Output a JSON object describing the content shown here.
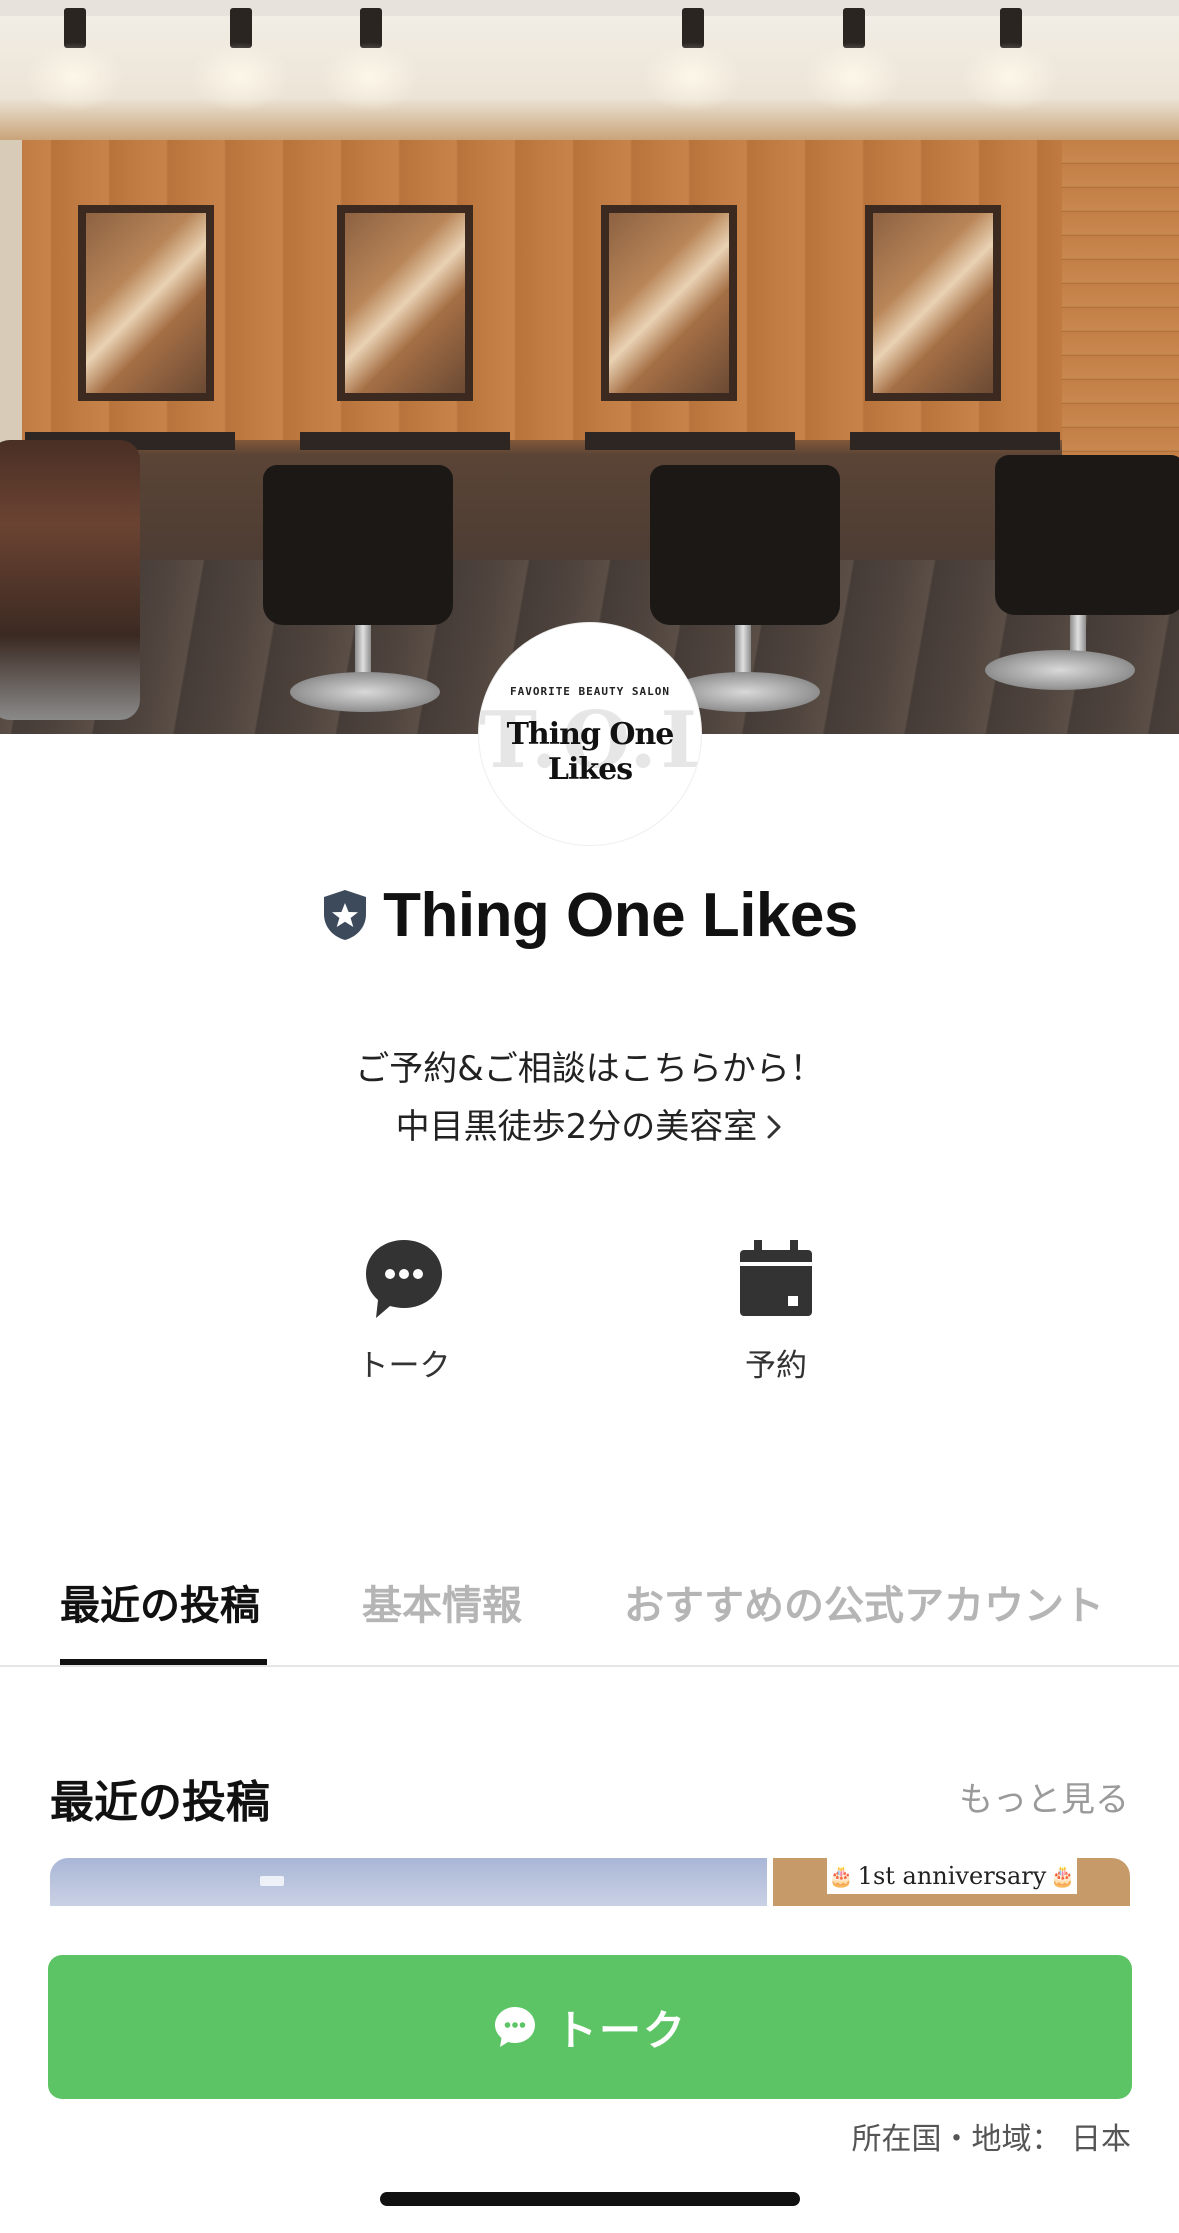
{
  "profile": {
    "name": "Thing One Likes",
    "avatar_tagline": "FAVORITE BEAUTY SALON",
    "avatar_logo": "Thing One Likes",
    "avatar_watermark": "T.O.L",
    "description_line1": "ご予約&ご相談はこちらから！",
    "description_line2": "中目黒徒歩2分の美容室"
  },
  "actions": [
    {
      "label": "トーク",
      "icon": "chat-bubble-icon"
    },
    {
      "label": "予約",
      "icon": "calendar-icon"
    }
  ],
  "tabs": [
    {
      "label": "最近の投稿",
      "active": true
    },
    {
      "label": "基本情報",
      "active": false
    },
    {
      "label": "おすすめの公式アカウント",
      "active": false
    }
  ],
  "recent_posts": {
    "title": "最近の投稿",
    "more_label": "もっと見る",
    "post2_caption": "1st anniversary"
  },
  "talk_button": {
    "label": "トーク",
    "icon": "chat-bubble-icon"
  },
  "region": "所在国・地域： 日本",
  "colors": {
    "line_green": "#5dc465",
    "active_tab": "#111111",
    "inactive_tab": "#b5b5b5",
    "badge": "#3d4a5c"
  }
}
